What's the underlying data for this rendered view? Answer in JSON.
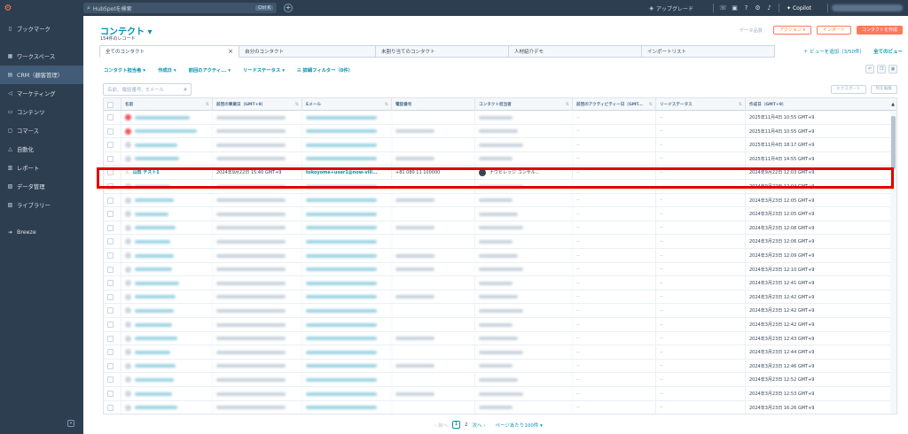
{
  "topbar": {
    "search_placeholder": "HubSpotを検索",
    "search_shortcut": "Ctrl K",
    "upgrade_label": "アップグレード",
    "copilot_label": "Copilot"
  },
  "sidebar": {
    "items": [
      {
        "label": "ブックマーク",
        "icon": "bookmark-icon"
      },
      {
        "label": "ワークスペース",
        "icon": "workspace-icon"
      },
      {
        "label": "CRM（顧客管理）",
        "icon": "crm-icon"
      },
      {
        "label": "マーケティング",
        "icon": "marketing-icon"
      },
      {
        "label": "コンテンツ",
        "icon": "content-icon"
      },
      {
        "label": "コマース",
        "icon": "commerce-icon"
      },
      {
        "label": "自動化",
        "icon": "automation-icon"
      },
      {
        "label": "レポート",
        "icon": "reports-icon"
      },
      {
        "label": "データ管理",
        "icon": "data-icon"
      },
      {
        "label": "ライブラリー",
        "icon": "library-icon"
      },
      {
        "label": "Breeze",
        "icon": "breeze-icon"
      }
    ]
  },
  "header": {
    "title": "コンテクト",
    "title_caret": "▾",
    "record_count": "154件のレコード",
    "data_quality_label": "データ品質",
    "actions_label": "アクション ▾",
    "import_label": "インポート",
    "create_label": "コンタクトを作成"
  },
  "view_tabs": {
    "tabs": [
      "全てのコンタクト",
      "自分のコンタクト",
      "未割り当てのコンタクト",
      "人材紹介デモ",
      "インポートリスト"
    ],
    "add_view_label": "ビューを追加（3/50件）",
    "all_views_label": "全てのビュー"
  },
  "filters": {
    "items": [
      "コンタクト担当者",
      "作成日",
      "前回のアクティ...",
      "リードステータス"
    ],
    "advanced_label": "詳細フィルター（0件）"
  },
  "table_toolbar": {
    "search_placeholder": "名前、電話番号、Eメール",
    "export_label": "エクスポート",
    "edit_columns_label": "列を編集"
  },
  "table": {
    "columns": [
      "名前",
      "前回の事業日（GMT+9）",
      "Eメール",
      "電話番号",
      "コンタクト担当者",
      "前回のアクティビティー日（GMT...",
      "リードステータス",
      "作成日（GMT+9）"
    ],
    "highlighted": {
      "name": "山田 テスト1",
      "last_date": "2024年9月22日 15:40 GMT+9",
      "email": "tokoyome+user1@now-vill...",
      "phone": "+81 080 11 100000",
      "owner": "ナウビレッジ コンサル...",
      "activity": "--",
      "status": "--",
      "created": "2024年9月22日 12:03 GMT+9"
    },
    "created_dates": [
      "2025年11月4日 10:55 GMT+9",
      "2025年11月4日 10:55 GMT+9",
      "2025年11月4日 18:17 GMT+9",
      "2025年11月4日 14:55 GMT+9",
      "2024年9月22日 12:03 GMT+9",
      "2024年9月22日 12:04 GMT+9",
      "2024年3月23日 12:05 GMT+9",
      "2024年3月23日 12:05 GMT+9",
      "2024年3月23日 12:08 GMT+9",
      "2024年3月23日 12:06 GMT+9",
      "2024年3月23日 12:09 GMT+9",
      "2024年3月23日 12:10 GMT+9",
      "2024年3月23日 12:41 GMT+9",
      "2024年3月23日 12:42 GMT+9",
      "2024年3月23日 12:42 GMT+9",
      "2024年3月23日 12:42 GMT+9",
      "2024年3月23日 12:43 GMT+9",
      "2024年3月23日 12:44 GMT+9",
      "2024年3月23日 12:46 GMT+9",
      "2024年3月23日 12:52 GMT+9",
      "2024年3月23日 12:53 GMT+9",
      "2024年3月23日 16:26 GMT+9",
      "2024年3月23日 16:00 GMT+9"
    ],
    "empty_value": "--"
  },
  "pagination": {
    "prev_label": "前へ",
    "current_page": "1",
    "next_page": "2",
    "next_label": "次へ",
    "per_page_label": "ページあたり100件 ▾"
  },
  "colors": {
    "sidebar_bg": "#2d3e50",
    "link": "#0091ae",
    "accent": "#ff7a59",
    "highlight_border": "#e00000"
  }
}
